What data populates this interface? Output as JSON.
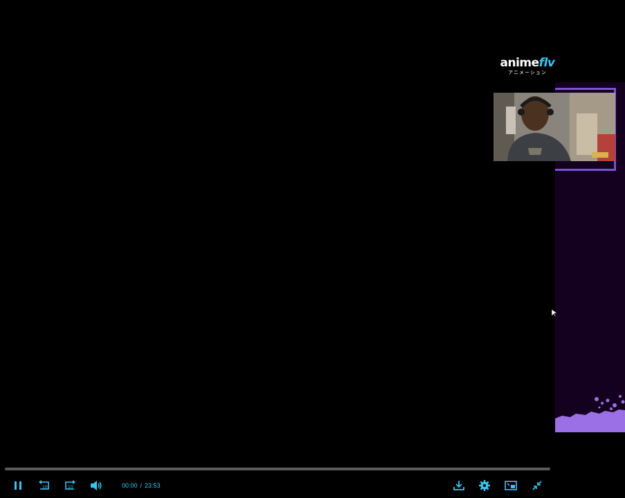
{
  "logo": {
    "brand_main": "anime",
    "brand_accent": "flv",
    "subtitle": "アニメーション"
  },
  "player": {
    "current_time": "00:00",
    "separator": "/",
    "duration": "23:53",
    "progress_fraction": 0.0,
    "accent_color": "#38c5f2"
  },
  "icons": {
    "pause": "pause-icon",
    "rewind": "rewind-10-icon",
    "forward": "forward-10-icon",
    "volume": "volume-icon",
    "download": "download-icon",
    "settings": "gear-icon",
    "pip": "picture-in-picture-icon",
    "exit_fullscreen": "exit-fullscreen-icon"
  },
  "colors": {
    "side_panel_bg": "#14001f",
    "side_panel_accent": "#7b52d6"
  }
}
